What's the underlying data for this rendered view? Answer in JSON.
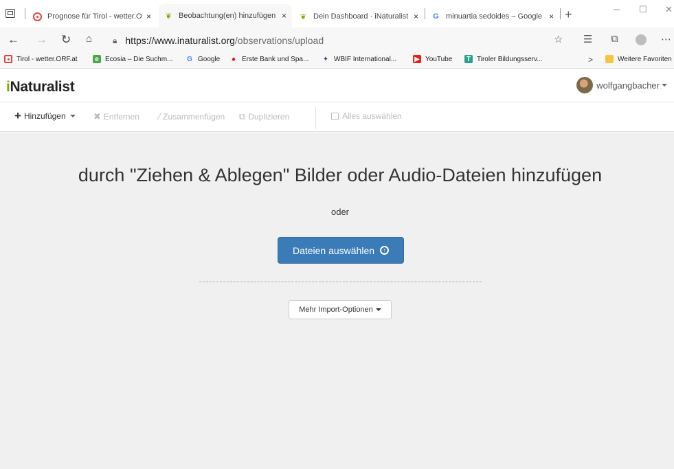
{
  "browser": {
    "tabs": [
      {
        "title": "Prognose für Tirol - wetter.ORF.at",
        "favicon": "orf-icon"
      },
      {
        "title": "Beobachtung(en) hinzufügen | iNaturalist",
        "favicon": "inaturalist-icon"
      },
      {
        "title": "Dein Dashboard · iNaturalist",
        "favicon": "inaturalist-icon"
      },
      {
        "title": "minuartia sedoides – Google Suche",
        "favicon": "google-icon"
      }
    ],
    "tab_close_glyph": "×",
    "new_tab_glyph": "+",
    "url_host": "https://www.inaturalist.org",
    "url_path": "/observations/upload",
    "favorites": [
      {
        "label": "Tirol - wetter.ORF.at",
        "icon": "orf-icon"
      },
      {
        "label": "Ecosia – Die Suchm...",
        "icon": "ecosia-icon"
      },
      {
        "label": "Google",
        "icon": "google-icon"
      },
      {
        "label": "Erste Bank und Spa...",
        "icon": "sparkasse-icon"
      },
      {
        "label": "WBIF International...",
        "icon": "wbif-icon"
      },
      {
        "label": "YouTube",
        "icon": "youtube-icon"
      },
      {
        "label": "Tiroler Bildungsserv...",
        "icon": "tirol-icon"
      }
    ],
    "favorites_more": ">",
    "other_favorites": "Weitere Favoriten"
  },
  "header": {
    "logo_i": "i",
    "logo_rest": "Naturalist",
    "username": "wolfgangbacher"
  },
  "toolbar": {
    "add": "Hinzufügen",
    "remove": "Entfernen",
    "merge": "Zusammenfügen",
    "duplicate": "Duplizieren",
    "select_all": "Alles auswählen"
  },
  "main": {
    "drop_title": "durch \"Ziehen & Ablegen\" Bilder oder Audio-Dateien hinzufügen",
    "or": "oder",
    "choose_files": "Dateien auswählen",
    "more_import": "Mehr Import-Optionen"
  },
  "colors": {
    "inat_green": "#74ac00",
    "primary_button": "#3a7bb8",
    "drop_area_bg": "#f0f0f0"
  }
}
